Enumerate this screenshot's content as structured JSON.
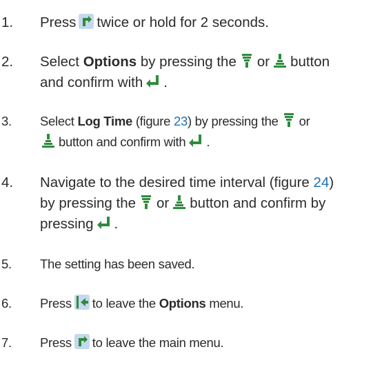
{
  "steps": [
    {
      "num": "1.",
      "a": "Press",
      "b": "twice or hold for 2 seconds."
    },
    {
      "num": "2.",
      "a": "Select",
      "bold": "Options",
      "b": "by pressing the",
      "or": "or",
      "c": "button",
      "d": "and confirm with",
      "end": "."
    },
    {
      "num": "3.",
      "a": "Select",
      "bold": "Log Time",
      "b": "(figure",
      "ref": "23",
      "c": ") by pressing the",
      "or": "or",
      "d": "button and confirm with",
      "end": "."
    },
    {
      "num": "4.",
      "a": "Navigate to the desired time interval (figure",
      "ref": "24",
      "b": ")",
      "c": "by pressing the",
      "or": "or",
      "d": "button and confirm by",
      "e": "pressing",
      "end": "."
    },
    {
      "num": "5.",
      "a": "The setting has been saved."
    },
    {
      "num": "6.",
      "a": "Press",
      "b": "to leave the",
      "bold": "Options",
      "c": "menu."
    },
    {
      "num": "7.",
      "a": "Press",
      "b": "to leave the main menu."
    }
  ],
  "icons": {
    "menu": "menu-key-icon",
    "down": "down-arrow-key-icon",
    "up": "up-arrow-key-icon",
    "enter": "enter-key-icon",
    "back": "back-key-icon",
    "icon_color": "#2e8b3d",
    "icon_bg": "#c6d8ee"
  }
}
